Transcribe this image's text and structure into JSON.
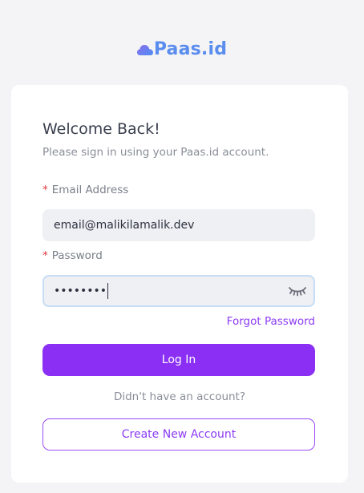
{
  "logo": {
    "text": "Paas.id",
    "icon": "cloud-logo-icon",
    "color": "#5b8dee"
  },
  "form": {
    "title": "Welcome Back!",
    "subtitle": "Please sign in using your Paas.id account.",
    "email": {
      "required_mark": "*",
      "label": "Email Address",
      "value": "email@malikilamalik.dev"
    },
    "password": {
      "required_mark": "*",
      "label": "Password",
      "masked_value": "••••••••",
      "toggle_icon": "eye-closed-icon"
    },
    "forgot_label": "Forgot Password",
    "login_label": "Log In",
    "no_account_text": "Didn't have an account?",
    "create_label": "Create New Account"
  },
  "colors": {
    "accent": "#8a2ff3",
    "background": "#f4f4f6",
    "card": "#ffffff",
    "required": "#e0383e"
  }
}
